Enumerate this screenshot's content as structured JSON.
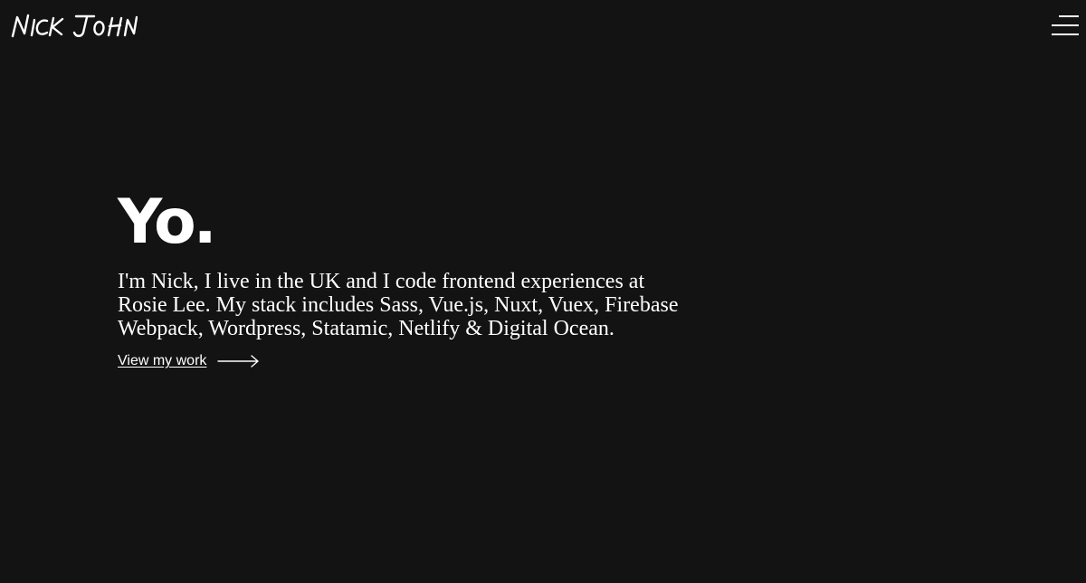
{
  "header": {
    "logo_text": "NICK JOHN",
    "menu_icon": "hamburger-menu-icon"
  },
  "hero": {
    "heading": "Yo.",
    "intro": "I'm Nick, I live in the UK and I code frontend experiences at Rosie Lee. My stack includes Sass, Vue.js, Nuxt, Vuex, Firebase Webpack, Wordpress, Statamic, Netlify & Digital Ocean.",
    "cta_label": "View my work",
    "cta_icon": "arrow-right-icon"
  },
  "colors": {
    "background": "#131313",
    "text": "#ffffff"
  }
}
